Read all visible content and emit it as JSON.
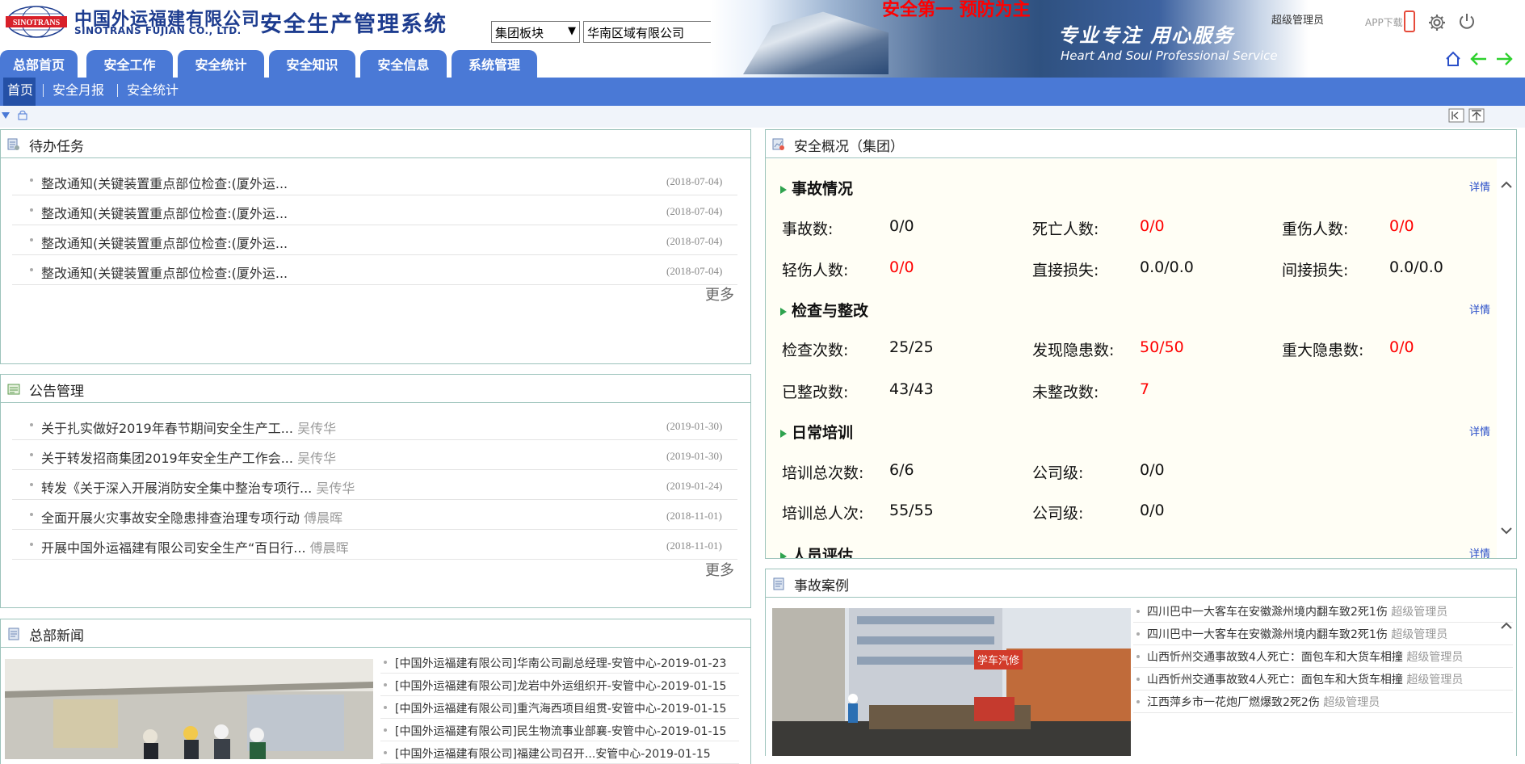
{
  "header": {
    "logo_text": "SINOTRANS",
    "company_cn": "中国外运福建有限公司",
    "company_en": "SINOTRANS FUJIAN CO., LTD.",
    "system_title": "安全生产管理系统",
    "selects": [
      {
        "value": "集团板块"
      },
      {
        "value": "华南区域有限公司"
      }
    ],
    "banner": {
      "slogan": "安全第一 预防为主",
      "cn": "专业专注 用心服务",
      "en": "Heart And Soul Professional Service"
    },
    "user": "超级管理员",
    "app_download": "APP下载",
    "icons": {
      "phone": "phone-icon",
      "settings": "gear-icon",
      "logout": "power-icon",
      "home": "home-icon",
      "back": "arrow-left-icon",
      "forward": "arrow-right-icon"
    }
  },
  "nav": {
    "tabs": [
      {
        "label": "总部首页"
      },
      {
        "label": "安全工作"
      },
      {
        "label": "安全统计"
      },
      {
        "label": "安全知识"
      },
      {
        "label": "安全信息"
      },
      {
        "label": "系统管理"
      }
    ]
  },
  "subnav": {
    "items": [
      {
        "label": "首页"
      },
      {
        "label": "安全月报"
      },
      {
        "label": "安全统计"
      }
    ]
  },
  "todo": {
    "title": "待办任务",
    "items": [
      {
        "text": "整改通知(关键装置重点部位检查:(厦外运...",
        "date": "(2018-07-04)"
      },
      {
        "text": "整改通知(关键装置重点部位检查:(厦外运...",
        "date": "(2018-07-04)"
      },
      {
        "text": "整改通知(关键装置重点部位检查:(厦外运...",
        "date": "(2018-07-04)"
      },
      {
        "text": "整改通知(关键装置重点部位检查:(厦外运...",
        "date": "(2018-07-04)"
      }
    ],
    "more": "更多"
  },
  "notice": {
    "title": "公告管理",
    "items": [
      {
        "text": "关于扎实做好2019年春节期间安全生产工...",
        "author": "吴传华",
        "date": "(2019-01-30)"
      },
      {
        "text": "关于转发招商集团2019年安全生产工作会...",
        "author": "吴传华",
        "date": "(2019-01-30)"
      },
      {
        "text": "转发《关于深入开展消防安全集中整治专项行...",
        "author": "吴传华",
        "date": "(2019-01-24)"
      },
      {
        "text": "全面开展火灾事故安全隐患排查治理专项行动",
        "author": "傅晨晖",
        "date": "(2018-11-01)"
      },
      {
        "text": "开展中国外运福建有限公司安全生产“百日行...",
        "author": "傅晨晖",
        "date": "(2018-11-01)"
      }
    ],
    "more": "更多"
  },
  "news": {
    "title": "总部新闻",
    "items": [
      {
        "text": "[中国外运福建有限公司]华南公司副总经理-安管中心-2019-01-23"
      },
      {
        "text": "[中国外运福建有限公司]龙岩中外运组织开-安管中心-2019-01-15"
      },
      {
        "text": "[中国外运福建有限公司]重汽海西项目组贯-安管中心-2019-01-15"
      },
      {
        "text": "[中国外运福建有限公司]民生物流事业部襄-安管中心-2019-01-15"
      },
      {
        "text": "[中国外运福建有限公司]福建公司召开...安管中心-2019-01-15"
      }
    ]
  },
  "overview": {
    "title": "安全概况（集团）",
    "detail_label": "详情",
    "sections": [
      {
        "title": "事故情况",
        "rows": [
          [
            {
              "label": "事故数:",
              "value": "0/0",
              "color": "#111111"
            },
            {
              "label": "死亡人数:",
              "value": "0/0",
              "color": "#ff0000"
            },
            {
              "label": "重伤人数:",
              "value": "0/0",
              "color": "#ff0000"
            }
          ],
          [
            {
              "label": "轻伤人数:",
              "value": "0/0",
              "color": "#ff0000"
            },
            {
              "label": "直接损失:",
              "value": "0.0/0.0",
              "color": "#111111"
            },
            {
              "label": "间接损失:",
              "value": "0.0/0.0",
              "color": "#111111"
            }
          ]
        ]
      },
      {
        "title": "检查与整改",
        "rows": [
          [
            {
              "label": "检查次数:",
              "value": "25/25",
              "color": "#111111"
            },
            {
              "label": "发现隐患数:",
              "value": "50/50",
              "color": "#ff0000"
            },
            {
              "label": "重大隐患数:",
              "value": "0/0",
              "color": "#ff0000"
            }
          ],
          [
            {
              "label": "已整改数:",
              "value": "43/43",
              "color": "#111111"
            },
            {
              "label": "未整改数:",
              "value": "7",
              "color": "#ff0000"
            }
          ]
        ]
      },
      {
        "title": "日常培训",
        "rows": [
          [
            {
              "label": "培训总次数:",
              "value": "6/6",
              "color": "#111111"
            },
            {
              "label": "公司级:",
              "value": "0/0",
              "color": "#111111"
            }
          ],
          [
            {
              "label": "培训总人次:",
              "value": "55/55",
              "color": "#111111"
            },
            {
              "label": "公司级:",
              "value": "0/0",
              "color": "#111111"
            }
          ]
        ]
      },
      {
        "title": "人员评估",
        "rows": []
      }
    ]
  },
  "cases": {
    "title": "事故案例",
    "items": [
      {
        "text": "四川巴中一大客车在安徽滁州境内翻车致2死1伤",
        "author": "超级管理员"
      },
      {
        "text": "四川巴中一大客车在安徽滁州境内翻车致2死1伤",
        "author": "超级管理员"
      },
      {
        "text": "山西忻州交通事故致4人死亡：面包车和大货车相撞",
        "author": "超级管理员"
      },
      {
        "text": "山西忻州交通事故致4人死亡：面包车和大货车相撞",
        "author": "超级管理员"
      },
      {
        "text": "江西萍乡市一花炮厂燃爆致2死2伤",
        "author": "超级管理员"
      }
    ],
    "photo_sign": "学车汽修"
  },
  "colors": {
    "nav_blue": "#4a79d6",
    "title_blue": "#1d3c8f",
    "border_green": "#9cc3bb",
    "alert_red": "#ff0000"
  }
}
